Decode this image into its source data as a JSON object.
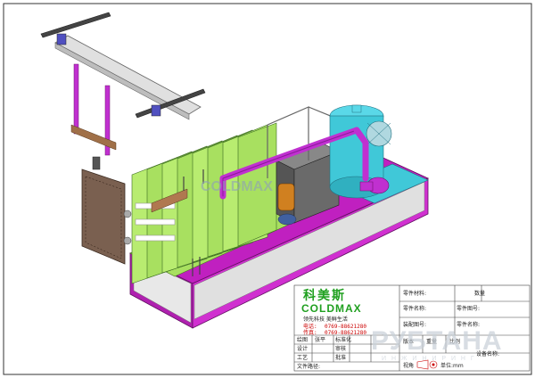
{
  "colors": {
    "platform_top": "#a8e060",
    "platform_side": "#c020c0",
    "frame_magenta": "#b030c8",
    "cabinet_brown": "#7a6050",
    "pipe_magenta": "#c030d0",
    "tank_cyan": "#40c8d8",
    "rail_gray": "#d8d8d8",
    "logo_green": "#20a020"
  },
  "title_block": {
    "logo_cn": "科美斯",
    "logo_brand": "COLDMAX",
    "slogan": "领先科技  美鲜生活",
    "phone_label": "电话:",
    "phone": "0769-88621280",
    "fax_label": "传真:",
    "fax": "0769-88621280",
    "part_material_label": "零件材料:",
    "quantity_label": "数量",
    "part_drawing_label": "零件图号:",
    "part_name_label": "零件名称:",
    "assembly_label": "装配图号:",
    "assembly_name_label": "零件名称:",
    "equipment_name_label": "设备名称:",
    "draw_label": "绘图",
    "draw_name": "张平",
    "standard_label": "标准化",
    "design_label": "设计",
    "review_label": "审核",
    "process_label": "工艺",
    "approve_label": "批准",
    "version_label": "版本",
    "weight_label": "重量",
    "scale_label": "比例",
    "file_path_label": "文件路径:",
    "view_label": "视角",
    "unit_label": "单位:mm"
  },
  "watermark": {
    "brand": "РУБТАНА",
    "sub": "И Н Ж И Н И Р И Н Г"
  }
}
